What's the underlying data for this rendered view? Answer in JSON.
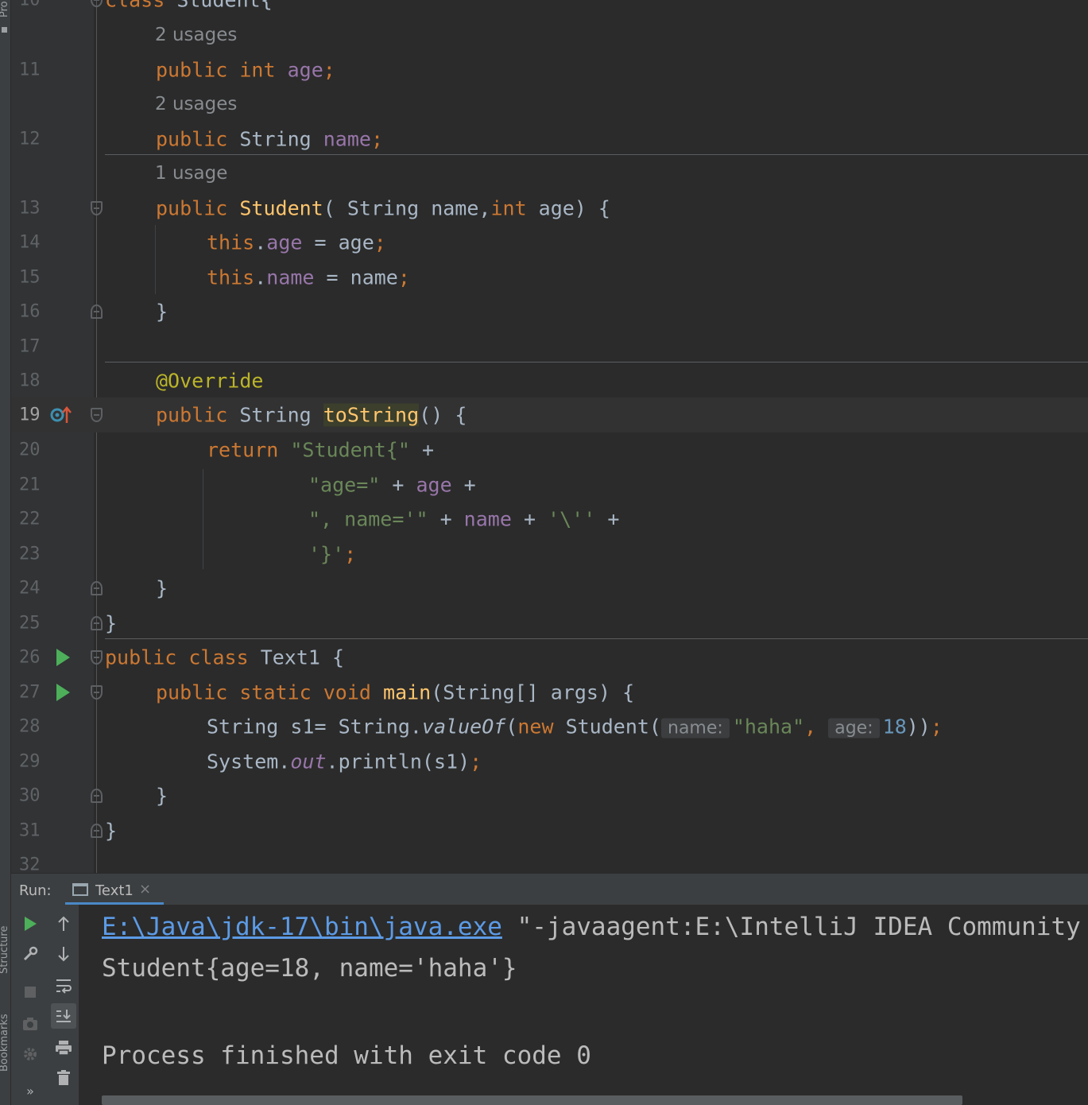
{
  "side_strip": {
    "top_label": "Pro",
    "structure_label": "Structure",
    "bookmarks_label": "Bookmarks",
    "more_label": "»"
  },
  "editor": {
    "lines": [
      {
        "num": "10",
        "code": "class Student{"
      },
      {
        "usage": "2 usages"
      },
      {
        "num": "11"
      },
      {
        "usage": "2 usages"
      },
      {
        "num": "12"
      },
      {
        "usage": "1 usage"
      },
      {
        "num": "13"
      },
      {
        "num": "14"
      },
      {
        "num": "15"
      },
      {
        "num": "16"
      },
      {
        "num": "17"
      },
      {
        "num": "18"
      },
      {
        "num": "19"
      },
      {
        "num": "20"
      },
      {
        "num": "21"
      },
      {
        "num": "22"
      },
      {
        "num": "23"
      },
      {
        "num": "24"
      },
      {
        "num": "25"
      },
      {
        "num": "26"
      },
      {
        "num": "27"
      },
      {
        "num": "28"
      },
      {
        "num": "29"
      },
      {
        "num": "30"
      },
      {
        "num": "31"
      },
      {
        "num": "32"
      }
    ],
    "tokens": {
      "public": "public",
      "int": "int",
      "String": "String",
      "age": "age",
      "name": "name",
      "semicolon": ";",
      "Student": "Student",
      "this": "this",
      "dot": ".",
      "assign": " = ",
      "close_brace": "}",
      "override": "@Override",
      "toString": "toString",
      "return": "return",
      "class": "class",
      "Text1": "Text1",
      "static": "static",
      "void": "void",
      "main": "main",
      "new": "new",
      "valueOf": "valueOf",
      "out": "out"
    },
    "strings": {
      "s_student": "\"Student{\"",
      "s_age": "\"age=\"",
      "s_name": "\", name='\"",
      "s_quote": "'\\''",
      "s_close": "'}'",
      "s_haha": "\"haha\""
    },
    "hints": {
      "name": "name:",
      "age": "age:"
    },
    "number_18": "18",
    "misc": {
      "ctor_open": "( ",
      "ctor_params_mid": " name,",
      "ctor_params_end": " age) {",
      "tostring_tail": "() {",
      "plus": " +",
      "class_open": " {",
      "main_args": "(String[] args) {",
      "s1_decl": "String s1= String.",
      "new_student": "Student(",
      "comma": ", ",
      "call_close": "))",
      "system": "System.",
      "println": ".println(s1)"
    }
  },
  "run_panel": {
    "label": "Run:",
    "tab_title": "Text1",
    "tab_close": "×",
    "console": {
      "exe_path": "E:\\Java\\jdk-17\\bin\\java.exe",
      "args_text": " \"-javaagent:E:\\IntelliJ IDEA Community Edition",
      "output_line": "Student{age=18, name='haha'}",
      "exit_line": "Process finished with exit code 0"
    }
  }
}
